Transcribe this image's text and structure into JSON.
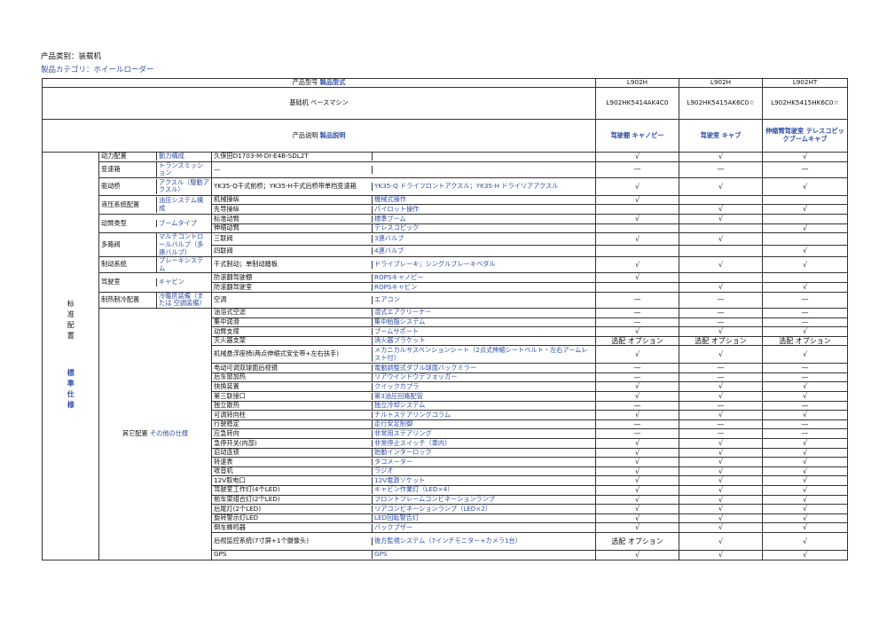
{
  "category_line": "产品类别：装载机",
  "category_line_jp": "製品カテゴリ：ホイールローダー",
  "header": {
    "model_cn": "产品型号",
    "model_jp": "製品型式",
    "models": [
      "L902H",
      "L902H",
      "L902HT"
    ],
    "base_cn": "基础机",
    "base_jp": "ベースマシン",
    "base_codes": [
      "L902HK5414AK4C0",
      "L902HK5415AK6C0☆",
      "L902HK5415HK6C0☆"
    ],
    "desc_cn": "产品说明",
    "desc_jp": "製品説明",
    "descs": [
      "驾驶棚 キャノピー",
      "驾驶室 キャブ",
      "伸缩臂驾驶室 テレスコピックブームキャブ"
    ]
  },
  "side": {
    "cn": "标准配置",
    "jp": "標準仕様"
  },
  "groups": [
    {
      "cn": "动力配置",
      "jp": "動力構成",
      "rows": [
        {
          "spec": "久保田D1703-M-DI-E4B-SDL2T",
          "jp": "",
          "v": [
            "√",
            "√",
            "√"
          ]
        }
      ]
    },
    {
      "cn": "变速箱",
      "jp": "トランスミッション",
      "rows": [
        {
          "spec": "—",
          "jp": "",
          "v": [
            "—",
            "—",
            "—"
          ]
        }
      ]
    },
    {
      "cn": "驱动桥",
      "jp": "アクスル（駆動アクスル）",
      "rows": [
        {
          "spec": "YK35-Q干式前桥；YK35-H干式后桥带单档变速箱",
          "jp": "YK35-Q ドライフロントアクスル；YK35-H ドライリアアクスル",
          "v": [
            "√",
            "√",
            "√"
          ]
        }
      ]
    },
    {
      "cn": "液压系统配置",
      "jp": "油圧システム構成",
      "rows": [
        {
          "spec": "机械操纵",
          "jp": "機械式操作",
          "v": [
            "√",
            "",
            ""
          ]
        },
        {
          "spec": "先导操纵",
          "jp": "パイロット操作",
          "v": [
            "",
            "√",
            "√"
          ]
        }
      ]
    },
    {
      "cn": "动臂类型",
      "jp": "ブームタイプ",
      "rows": [
        {
          "spec": "标准动臂",
          "jp": "標準ブーム",
          "v": [
            "√",
            "√",
            ""
          ]
        },
        {
          "spec": "伸缩动臂",
          "jp": "テレスコピック",
          "v": [
            "",
            "",
            "√"
          ]
        }
      ]
    },
    {
      "cn": "多路阀",
      "jp": "マルチコントロールバルブ（多連バルブ）",
      "rows": [
        {
          "spec": "三联阀",
          "jp": "3連バルブ",
          "v": [
            "√",
            "√",
            ""
          ]
        },
        {
          "spec": "四联阀",
          "jp": "4連バルブ",
          "v": [
            "",
            "",
            "√"
          ]
        }
      ]
    },
    {
      "cn": "制动系统",
      "jp": "ブレーキシステム",
      "rows": [
        {
          "spec": "干式制动；单制动踏板",
          "jp": "ドライブレーキ；シングルブレーキペダル",
          "v": [
            "√",
            "√",
            "√"
          ]
        }
      ]
    },
    {
      "cn": "驾驶室",
      "jp": "キャビン",
      "rows": [
        {
          "spec": "防滚翻驾驶棚",
          "jp": "ROPSキャノピー",
          "v": [
            "√",
            "",
            ""
          ]
        },
        {
          "spec": "防滚翻驾驶室",
          "jp": "ROPSキャビン",
          "v": [
            "",
            "√",
            "√"
          ]
        }
      ]
    },
    {
      "cn": "制热制冷配置",
      "jp": "冷暖房装備（または 空調装備）",
      "rows": [
        {
          "spec": "空调",
          "jp": "エアコン",
          "v": [
            "—",
            "—",
            "—"
          ]
        }
      ]
    }
  ],
  "other": {
    "cn": "其它配置",
    "jp": "その他の仕様",
    "rows": [
      {
        "spec": "油浴式空滤",
        "jp": "湿式エアクリーナー",
        "v": [
          "—",
          "—",
          "—"
        ]
      },
      {
        "spec": "集中润滑",
        "jp": "集中給脂システム",
        "v": [
          "—",
          "—",
          "—"
        ]
      },
      {
        "spec": "动臂支撑",
        "jp": "ブームサポート",
        "v": [
          "√",
          "√",
          "√"
        ]
      },
      {
        "spec": "灭火器支架",
        "jp": "消火器ブラケット",
        "v": [
          "选配 オプション",
          "选配 オプション",
          "选配 オプション"
        ]
      },
      {
        "spec": "机械悬浮座椅(两点伸缩式安全带+左右扶手)",
        "jp": "メカニカルサスペンションシート（2点式伸縮シートベルト・左右アームレスト付）",
        "v": [
          "√",
          "√",
          "√"
        ]
      },
      {
        "spec": "电动可调双球面后视镜",
        "jp": "電動調整式ダブル球面バックミラー",
        "v": [
          "—",
          "—",
          "—"
        ]
      },
      {
        "spec": "后车窗加热",
        "jp": "リアウインドウデフォッガー",
        "v": [
          "—",
          "—",
          "—"
        ]
      },
      {
        "spec": "快换装置",
        "jp": "クイックカプラ",
        "v": [
          "√",
          "√",
          "√"
        ]
      },
      {
        "spec": "第三联接口",
        "jp": "第3油圧回路配管",
        "v": [
          "√",
          "√",
          "√"
        ]
      },
      {
        "spec": "独立散热",
        "jp": "独立冷却システム",
        "v": [
          "—",
          "—",
          "—"
        ]
      },
      {
        "spec": "可调转向柱",
        "jp": "チルトステアリングコラム",
        "v": [
          "√",
          "√",
          "√"
        ]
      },
      {
        "spec": "行驶稳定",
        "jp": "走行安定制御",
        "v": [
          "—",
          "—",
          "—"
        ]
      },
      {
        "spec": "应急转向",
        "jp": "非常用ステアリング",
        "v": [
          "—",
          "—",
          "—"
        ]
      },
      {
        "spec": "急停开关(内部)",
        "jp": "非常停止スイッチ（車内）",
        "v": [
          "√",
          "√",
          "√"
        ]
      },
      {
        "spec": "启动连锁",
        "jp": "始動インターロック",
        "v": [
          "√",
          "√",
          "√"
        ]
      },
      {
        "spec": "转速表",
        "jp": "タコメーター",
        "v": [
          "√",
          "√",
          "√"
        ]
      },
      {
        "spec": "收音机",
        "jp": "ラジオ",
        "v": [
          "√",
          "√",
          "√"
        ]
      },
      {
        "spec": "12V取电口",
        "jp": "12V電源ソケット",
        "v": [
          "√",
          "√",
          "√"
        ]
      },
      {
        "spec": "驾驶室工作灯(4个LED)",
        "jp": "キャビン作業灯（LED×4）",
        "v": [
          "√",
          "√",
          "√"
        ]
      },
      {
        "spec": "前车架组合灯(2个LED)",
        "jp": "フロントフレームコンビネーションランプ",
        "v": [
          "√",
          "√",
          "√"
        ]
      },
      {
        "spec": "后尾灯(2个LED)",
        "jp": "リアコンビネーションランプ（LED×2）",
        "v": [
          "√",
          "√",
          "√"
        ]
      },
      {
        "spec": "旋转警示灯LED",
        "jp": "LED回転警告灯",
        "v": [
          "√",
          "√",
          "√"
        ]
      },
      {
        "spec": "倒车蜂鸣器",
        "jp": "バックブザー",
        "v": [
          "√",
          "√",
          "√"
        ]
      },
      {
        "spec": "后视监控系统(7寸屏+1个摄像头)",
        "jp": "後方監視システム（7インチモニター+カメラ1台）",
        "v": [
          "选配 オプション",
          "√",
          "√"
        ]
      },
      {
        "spec": "GPS",
        "jp": "GPS",
        "v": [
          "√",
          "√",
          "√"
        ]
      }
    ]
  }
}
